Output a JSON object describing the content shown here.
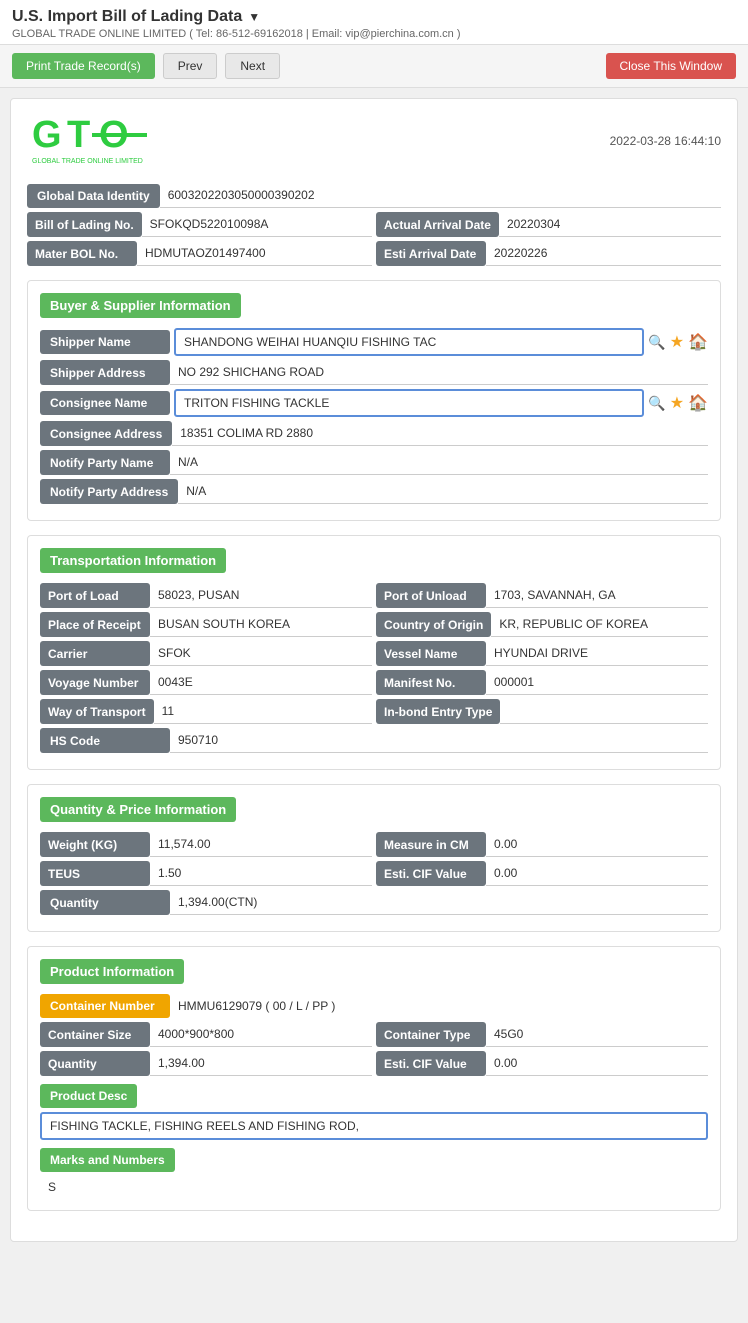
{
  "page": {
    "title": "U.S. Import Bill of Lading Data",
    "subtitle": "GLOBAL TRADE ONLINE LIMITED ( Tel: 86-512-69162018 | Email: vip@pierchina.com.cn )",
    "timestamp": "2022-03-28 16:44:10"
  },
  "toolbar": {
    "print_label": "Print Trade Record(s)",
    "prev_label": "Prev",
    "next_label": "Next",
    "close_label": "Close This Window"
  },
  "global_data": {
    "global_data_identity_label": "Global Data Identity",
    "global_data_identity_value": "6003202203050000390202",
    "bill_of_lading_no_label": "Bill of Lading No.",
    "bill_of_lading_no_value": "SFOKQD522010098A",
    "actual_arrival_date_label": "Actual Arrival Date",
    "actual_arrival_date_value": "20220304",
    "mater_bol_label": "Mater BOL No.",
    "mater_bol_value": "HDMUTAOZ01497400",
    "esti_arrival_date_label": "Esti Arrival Date",
    "esti_arrival_date_value": "20220226"
  },
  "buyer_supplier": {
    "section_title": "Buyer & Supplier Information",
    "shipper_name_label": "Shipper Name",
    "shipper_name_value": "SHANDONG WEIHAI HUANQIU FISHING TAC",
    "shipper_address_label": "Shipper Address",
    "shipper_address_value": "NO 292 SHICHANG ROAD",
    "consignee_name_label": "Consignee Name",
    "consignee_name_value": "TRITON FISHING TACKLE",
    "consignee_address_label": "Consignee Address",
    "consignee_address_value": "18351 COLIMA RD 2880",
    "notify_party_name_label": "Notify Party Name",
    "notify_party_name_value": "N/A",
    "notify_party_address_label": "Notify Party Address",
    "notify_party_address_value": "N/A"
  },
  "transportation": {
    "section_title": "Transportation Information",
    "port_of_load_label": "Port of Load",
    "port_of_load_value": "58023, PUSAN",
    "port_of_unload_label": "Port of Unload",
    "port_of_unload_value": "1703, SAVANNAH, GA",
    "place_of_receipt_label": "Place of Receipt",
    "place_of_receipt_value": "BUSAN SOUTH KOREA",
    "country_of_origin_label": "Country of Origin",
    "country_of_origin_value": "KR, REPUBLIC OF KOREA",
    "carrier_label": "Carrier",
    "carrier_value": "SFOK",
    "vessel_name_label": "Vessel Name",
    "vessel_name_value": "HYUNDAI DRIVE",
    "voyage_number_label": "Voyage Number",
    "voyage_number_value": "0043E",
    "manifest_no_label": "Manifest No.",
    "manifest_no_value": "000001",
    "way_of_transport_label": "Way of Transport",
    "way_of_transport_value": "11",
    "in_bond_entry_type_label": "In-bond Entry Type",
    "in_bond_entry_type_value": "",
    "hs_code_label": "HS Code",
    "hs_code_value": "950710"
  },
  "quantity_price": {
    "section_title": "Quantity & Price Information",
    "weight_kg_label": "Weight (KG)",
    "weight_kg_value": "11,574.00",
    "measure_in_cm_label": "Measure in CM",
    "measure_in_cm_value": "0.00",
    "teus_label": "TEUS",
    "teus_value": "1.50",
    "esti_cif_value_label": "Esti. CIF Value",
    "esti_cif_value_value": "0.00",
    "quantity_label": "Quantity",
    "quantity_value": "1,394.00(CTN)"
  },
  "product_info": {
    "section_title": "Product Information",
    "container_number_label": "Container Number",
    "container_number_value": "HMMU6129079 ( 00 / L / PP )",
    "container_size_label": "Container Size",
    "container_size_value": "4000*900*800",
    "container_type_label": "Container Type",
    "container_type_value": "45G0",
    "quantity_label": "Quantity",
    "quantity_value": "1,394.00",
    "esti_cif_label": "Esti. CIF Value",
    "esti_cif_value": "0.00",
    "product_desc_label": "Product Desc",
    "product_desc_value": "FISHING TACKLE, FISHING REELS AND FISHING ROD,",
    "marks_label": "Marks and Numbers",
    "marks_value": "S"
  },
  "icons": {
    "search": "🔍",
    "star": "★",
    "home": "🏠",
    "dropdown": "▼"
  }
}
